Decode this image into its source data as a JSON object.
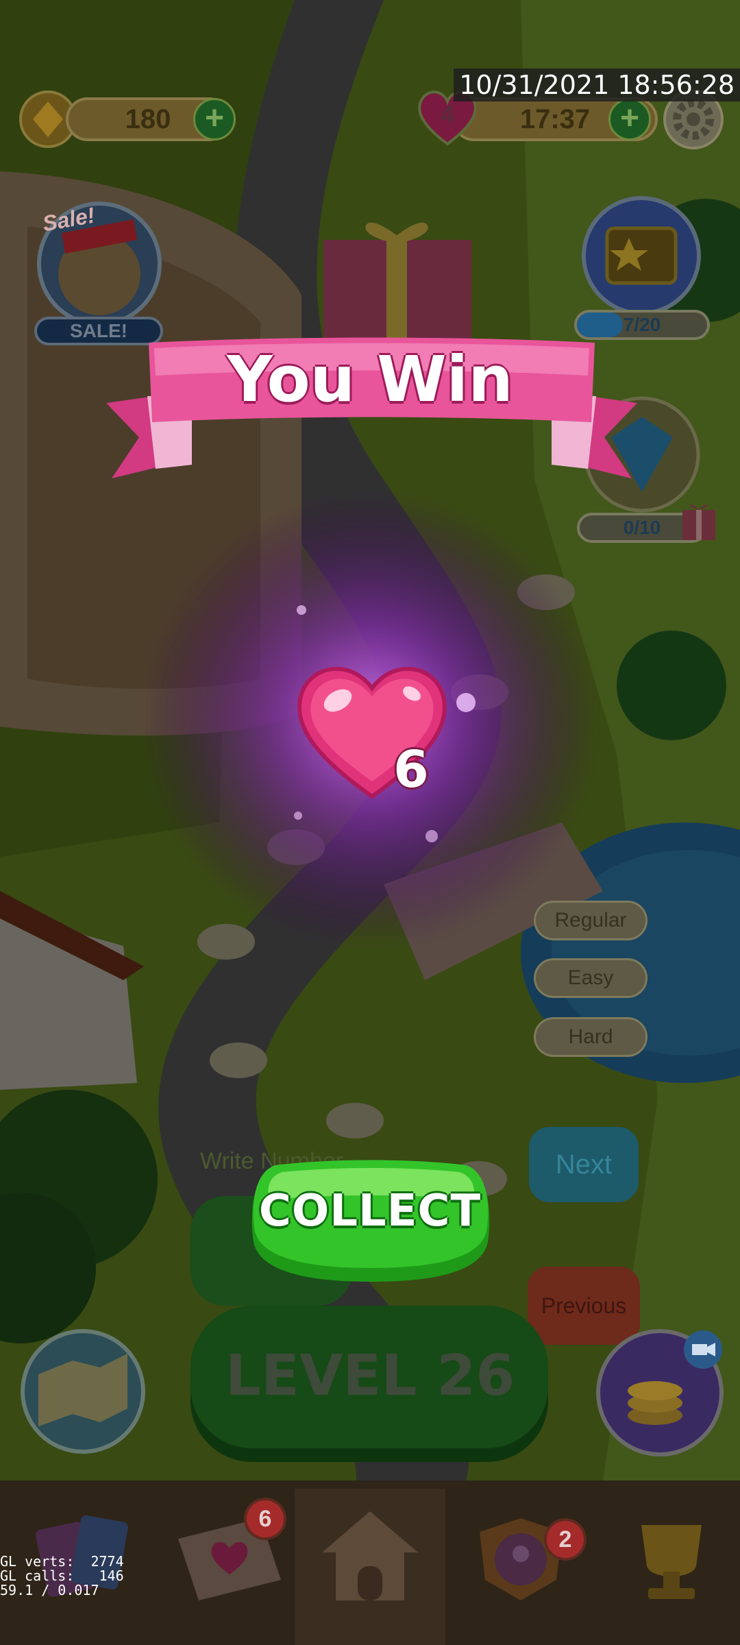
{
  "status_overlay": {
    "timestamp": "10/31/2021 18:56:28"
  },
  "top_bar": {
    "coins": "180",
    "lives": "4",
    "timer": "17:37"
  },
  "side_widgets": {
    "sale_tag": "Sale!",
    "sale_label": "SALE!",
    "star_chest_progress": "7/20",
    "star_chest_fraction": 0.35,
    "gem_progress": "0/10",
    "gem_fraction": 0.0
  },
  "difficulty_buttons": [
    "Regular",
    "Easy",
    "Hard"
  ],
  "number_input": {
    "placeholder": "Write Number"
  },
  "nav_buttons": {
    "next": "Next",
    "previous": "Previous"
  },
  "win_dialog": {
    "title": "You Win",
    "reward_count": "6",
    "collect_label": "COLLECT"
  },
  "level_button": {
    "label": "LEVEL 26"
  },
  "bottom_nav": {
    "mail_badge": "6",
    "team_badge": "2",
    "items": [
      "cards-icon",
      "mail-heart-icon",
      "home-icon",
      "team-icon",
      "trophy-icon"
    ]
  },
  "debug": {
    "verts_line": "GL verts:  2774",
    "calls_line": "GL calls:   146",
    "fps_line": "59.1 / 0.017"
  },
  "colors": {
    "ribbon_pink": "#e8559a",
    "collect_green": "#33c42a",
    "heart_pink": "#f2508d",
    "next_blue": "#1d6f8f",
    "previous_red": "#8c2a1c"
  }
}
